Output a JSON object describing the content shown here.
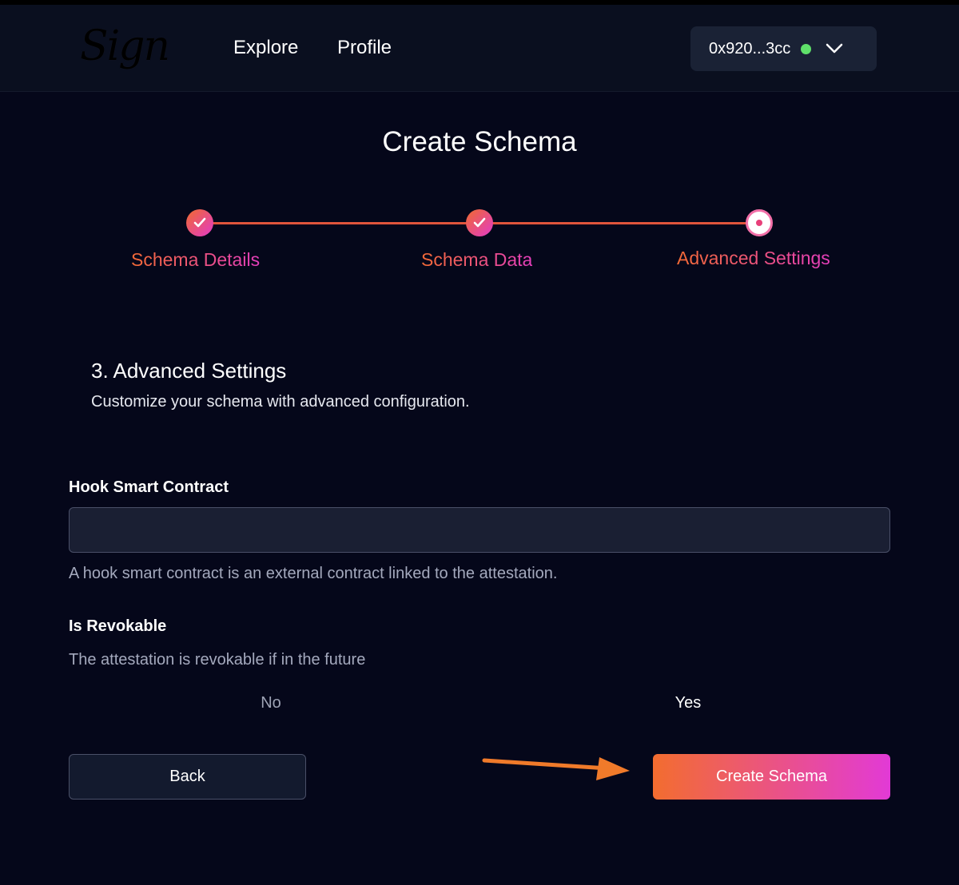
{
  "header": {
    "logo_text": "Sign",
    "nav": [
      "Explore",
      "Profile"
    ],
    "wallet": {
      "address": "0x920...3cc",
      "status_color": "#5fe06a"
    }
  },
  "page": {
    "title": "Create Schema"
  },
  "stepper": {
    "steps": [
      {
        "label": "Schema Details",
        "state": "complete"
      },
      {
        "label": "Schema Data",
        "state": "complete"
      },
      {
        "label": "Advanced Settings",
        "state": "active"
      }
    ]
  },
  "section": {
    "title": "3. Advanced Settings",
    "description": "Customize your schema with advanced configuration."
  },
  "hook": {
    "label": "Hook Smart Contract",
    "value": "",
    "hint": "A hook smart contract is an external contract linked to the attestation."
  },
  "revocable": {
    "label": "Is Revokable",
    "hint": "The attestation is revokable if in the future",
    "options": [
      "No",
      "Yes"
    ],
    "selected": "Yes"
  },
  "actions": {
    "back_label": "Back",
    "create_label": "Create Schema"
  },
  "colors": {
    "background": "#05071a",
    "accent_start": "#f36d2f",
    "accent_end": "#e23ad6",
    "annotation_arrow": "#f07a2a"
  }
}
